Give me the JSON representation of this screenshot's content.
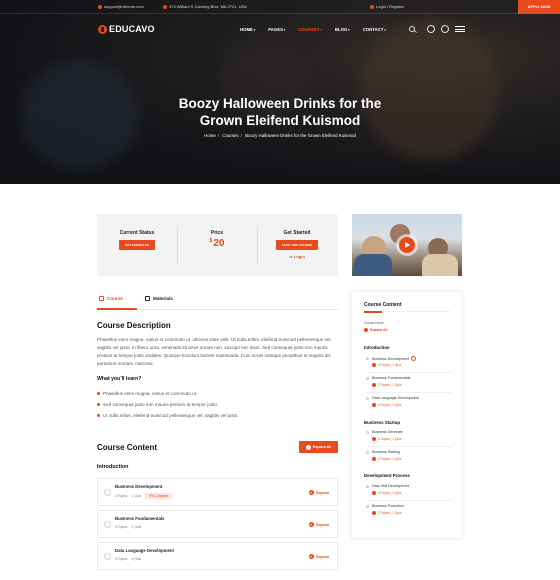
{
  "topbar": {
    "email": "support@rrtheme.com",
    "address": "374 William S Canning Blvd, MA 2721, USA",
    "login": "Login / Register",
    "apply": "APPLY NOW"
  },
  "brand": {
    "name": "EDUCAVO"
  },
  "nav": [
    "HOME",
    "PAGES",
    "COURSES",
    "BLOG",
    "CONTACT"
  ],
  "nav_active": "COURSES",
  "hero": {
    "title_line1": "Boozy Halloween Drinks for the",
    "title_line2": "Grown Eleifend Kuismod",
    "crumbs": [
      "Home",
      "Courses",
      "Boozy Halloween Drinks for the Grown Eleifend Kuismod"
    ]
  },
  "status": {
    "current_label": "Current Status",
    "current_btn": "NOT ENROLLED",
    "price_label": "Price",
    "price_currency": "$",
    "price_value": "20",
    "started_label": "Get Started",
    "started_btn": "TAKE THIS COURSE",
    "or": "or",
    "login": "Login"
  },
  "tabs": {
    "course": "Course",
    "materials": "Materials"
  },
  "description": {
    "title": "Course Description",
    "text": "Phasellus enim magna, varius et commodo ut, ultricies vitae velit. Ut nulla tellus, eleifend euismod pellentesque vel, sagittis vel justo. In libero urna, venenatis sit amet ornare non, suscipit nec risus. Sed consequat justo non mauris pretium at tempor justo sodales. Quisque tincidunt laoreet malesuada. Cum sociis natoque penatibus et magnis dis parturient montes, nascetur.",
    "learn_title": "What you'll learn?",
    "bullets": [
      "Phasellus enim magna, varius et commodo ut.",
      "Sed consequat justo non mauris pretium at tempor justo.",
      "Ut nulla tellus, eleifend euismod pellentesque vel, sagittis vel justo"
    ]
  },
  "content": {
    "title": "Course Content",
    "expand_all": "Expand All",
    "section": "Introduction",
    "lessons": [
      {
        "title": "Business Development",
        "topics": "3 Topics",
        "quiz": "1 Quiz",
        "badge": "0% Complete",
        "expand": "Expand"
      },
      {
        "title": "Business Fundamentals",
        "topics": "3 Topics",
        "quiz": "1 Quiz",
        "expand": "Expand"
      },
      {
        "title": "Data Language Development",
        "topics": "3 Topics",
        "quiz": "1 Quiz",
        "expand": "Expand"
      }
    ]
  },
  "sidebar": {
    "title": "Course Content",
    "course_home": "Course Home",
    "expand_all": "Expand All",
    "sections": [
      {
        "name": "Introduction",
        "items": [
          {
            "name": "Business Development",
            "meta": "3 Topics | 1 Quiz"
          },
          {
            "name": "Business Fundamentals",
            "meta": "3 Topics | 1 Quiz"
          },
          {
            "name": "Data Language Development",
            "meta": "3 Topics | 1 Quiz"
          }
        ]
      },
      {
        "name": "Business Startup",
        "items": [
          {
            "name": "Business Generate",
            "meta": "3 Topics | 1 Quiz"
          },
          {
            "name": "Business Starting",
            "meta": "3 Topics | 1 Quiz"
          }
        ]
      },
      {
        "name": "Development Process",
        "items": [
          {
            "name": "Data Skill Development",
            "meta": "3 Topics | 1 Quiz"
          },
          {
            "name": "Business Promotion",
            "meta": "3 Topics | 1 Quiz"
          }
        ]
      }
    ]
  },
  "colors": {
    "accent": "#e8491d",
    "dark": "#1e1e22"
  }
}
